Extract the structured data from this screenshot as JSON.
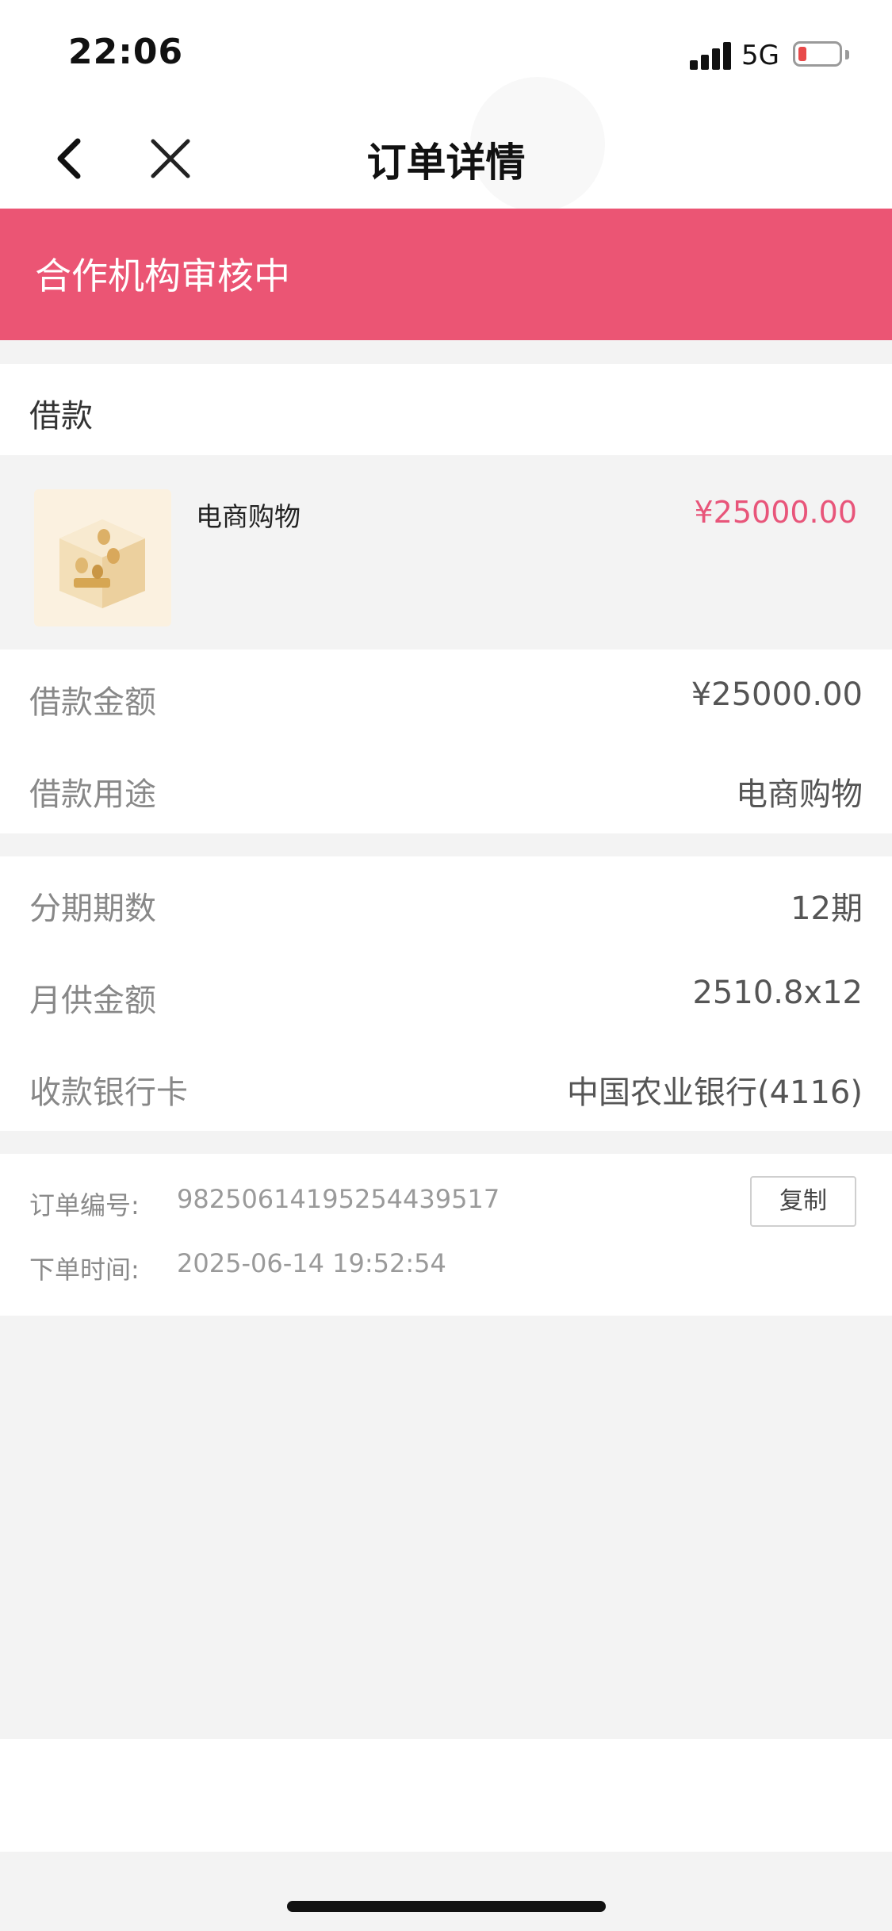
{
  "status_bar": {
    "time": "22:06",
    "network": "5G",
    "battery_level": 0.12
  },
  "nav": {
    "title": "订单详情",
    "back_icon": "chevron-left-icon",
    "close_icon": "close-icon"
  },
  "banner": {
    "status_text": "合作机构审核中",
    "color": "#eb5574"
  },
  "loan_section": {
    "title": "借款"
  },
  "product": {
    "name": "电商购物",
    "price": "¥25000.00",
    "price_color": "#e8557a",
    "thumb_icon": "coin-box-icon"
  },
  "details_a": [
    {
      "label": "借款金额",
      "value": "¥25000.00"
    },
    {
      "label": "借款用途",
      "value": "电商购物"
    }
  ],
  "details_b": [
    {
      "label": "分期期数",
      "value": "12期"
    },
    {
      "label": "月供金额",
      "value": "2510.8x12"
    },
    {
      "label": "收款银行卡",
      "value": "中国农业银行(4116)"
    }
  ],
  "order_info": {
    "order_no_label": "订单编号:",
    "order_no": "98250614195254439517",
    "copy_label": "复制",
    "time_label": "下单时间:",
    "time": "2025-06-14 19:52:54"
  }
}
